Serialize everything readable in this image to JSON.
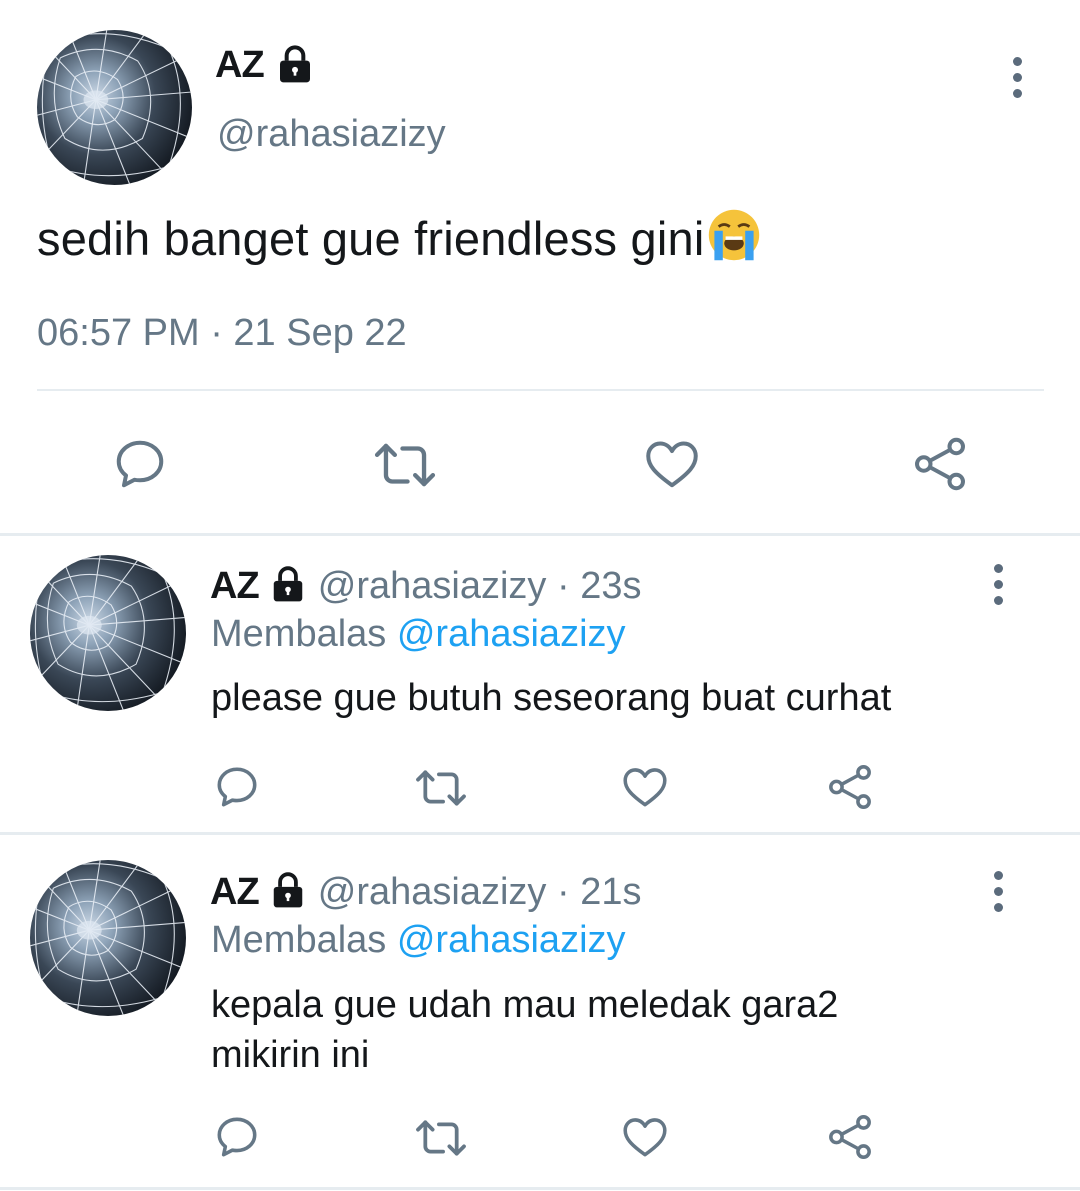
{
  "main_tweet": {
    "name": "AZ",
    "handle": "@rahasiazizy",
    "text": "sedih banget gue friendless gini",
    "emoji": "😭",
    "timestamp": "06:57 PM · 21 Sep 22",
    "icons": [
      "lock-icon",
      "more-options-icon",
      "reply-icon",
      "retweet-icon",
      "like-icon",
      "share-icon"
    ]
  },
  "replies": [
    {
      "name": "AZ",
      "handle": "@rahasiazizy",
      "time": "23s",
      "replying_label": "Membalas",
      "replying_to": "@rahasiazizy",
      "text": "please gue butuh seseorang buat curhat"
    },
    {
      "name": "AZ",
      "handle": "@rahasiazizy",
      "time": "21s",
      "replying_label": "Membalas",
      "replying_to": "@rahasiazizy",
      "text": "kepala gue udah mau meledak gara2 mikirin ini"
    }
  ],
  "colors": {
    "text": "#14171a",
    "secondary": "#657786",
    "link": "#1da1f2",
    "divider": "#e6ecf0",
    "emoji_face": "#f5c33b",
    "emoji_tears": "#3aa0f0"
  }
}
